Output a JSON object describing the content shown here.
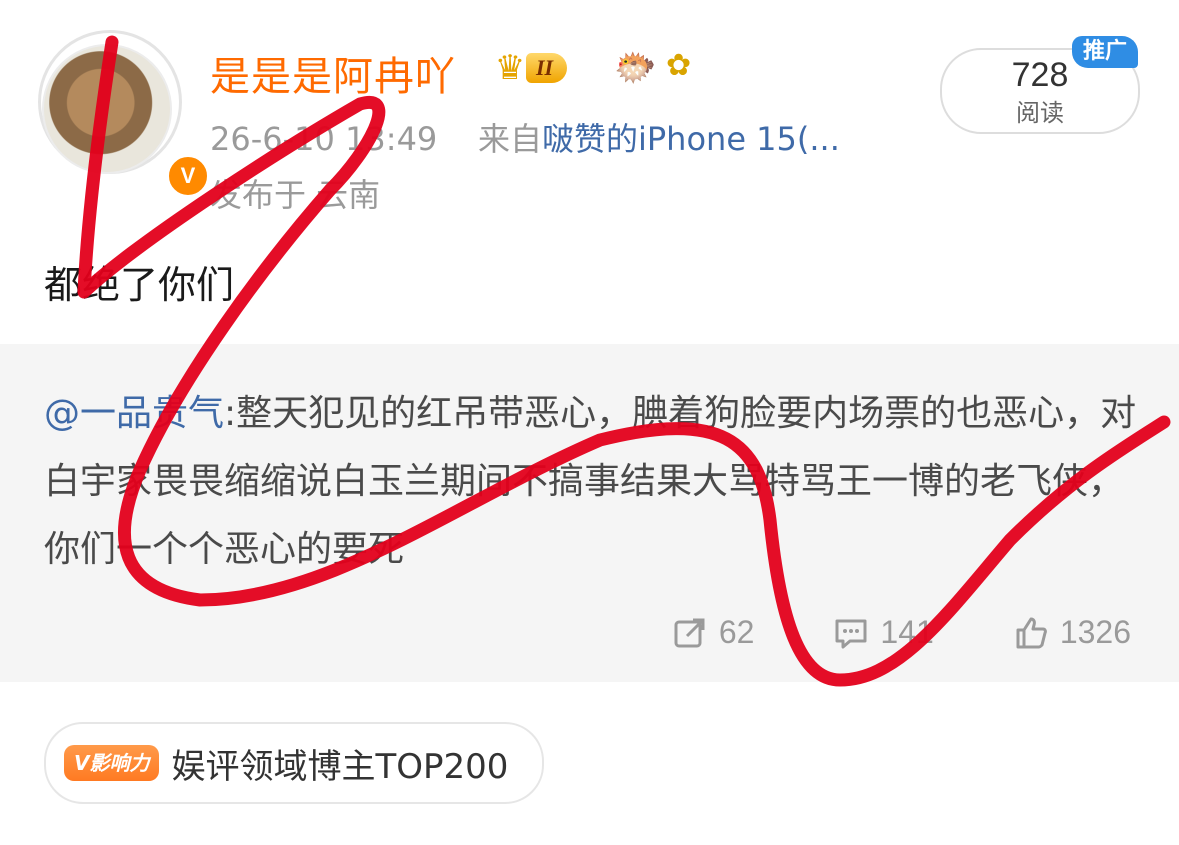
{
  "user": {
    "name": "是是是阿冉吖",
    "level_badge": "II",
    "verified_badge": "V"
  },
  "post": {
    "timestamp": "26-6-10 13:49",
    "source_prefix": "来自",
    "source_device": "啵赞的iPhone 15(...",
    "location": "发布于 云南",
    "text": "都绝了你们"
  },
  "reads": {
    "count": "728",
    "label": "阅读",
    "promo_tag": "推广"
  },
  "repost": {
    "mention": "@一品贵气",
    "text": ":整天犯见的红吊带恶心，腆着狗脸要内场票的也恶心，对白宇家畏畏缩缩说白玉兰期间不搞事结果大骂特骂王一博的老飞侠，你们一个个恶心的要死",
    "shares": "62",
    "comments": "141",
    "likes": "1326"
  },
  "influence": {
    "tag": "V影响力",
    "label": "娱评领域博主TOP200"
  },
  "icons": {
    "avatar": "rabbit-avatar",
    "crown": "crown-icon",
    "fish": "fish-emoji-icon",
    "flower": "flower-emoji-icon",
    "share": "share-icon",
    "comment": "comment-icon",
    "like": "like-icon"
  },
  "colors": {
    "username": "#ff6a00",
    "link": "#3f6aa8",
    "scribble": "#e3001b",
    "promo": "#2f8de4"
  }
}
